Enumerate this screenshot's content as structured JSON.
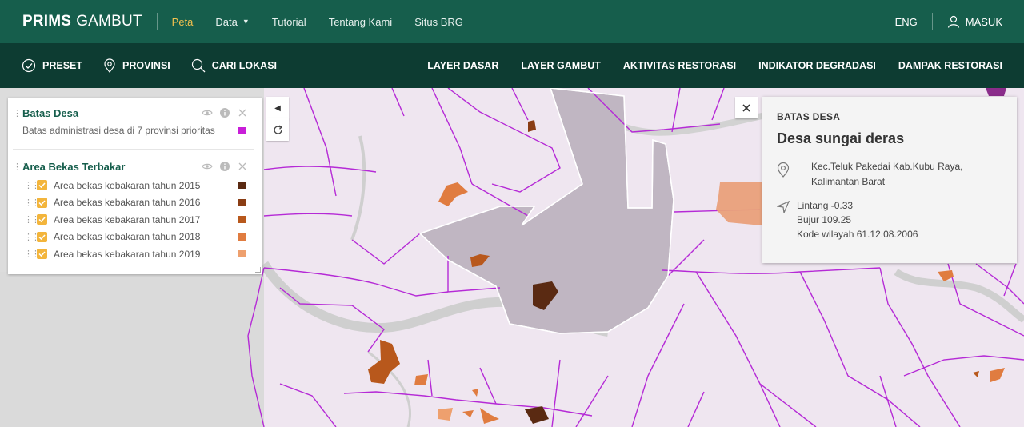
{
  "header": {
    "brand_bold": "PRIMS",
    "brand_light": "GAMBUT",
    "nav": [
      {
        "label": "Peta",
        "active": true
      },
      {
        "label": "Data",
        "has_caret": true
      },
      {
        "label": "Tutorial"
      },
      {
        "label": "Tentang Kami"
      },
      {
        "label": "Situs BRG"
      }
    ],
    "lang": "ENG",
    "login": "MASUK"
  },
  "subnav": {
    "left": [
      {
        "label": "PRESET",
        "icon": "check-circle-icon"
      },
      {
        "label": "PROVINSI",
        "icon": "map-pin-icon"
      },
      {
        "label": "CARI LOKASI",
        "icon": "search-icon"
      }
    ],
    "right": [
      "LAYER DASAR",
      "LAYER GAMBUT",
      "AKTIVITAS RESTORASI",
      "INDIKATOR DEGRADASI",
      "DAMPAK RESTORASI"
    ]
  },
  "legend": {
    "group1": {
      "title": "Batas Desa",
      "desc": "Batas administrasi desa di 7 provinsi prioritas",
      "color": "#c81ed8"
    },
    "group2": {
      "title": "Area Bekas Terbakar",
      "items": [
        {
          "label": "Area bekas kebakaran tahun 2015",
          "color": "#5a2a12"
        },
        {
          "label": "Area bekas kebakaran tahun 2016",
          "color": "#8a3d14"
        },
        {
          "label": "Area bekas kebakaran tahun 2017",
          "color": "#b8581c"
        },
        {
          "label": "Area bekas kebakaran tahun 2018",
          "color": "#e07c40"
        },
        {
          "label": "Area bekas kebakaran tahun 2019",
          "color": "#eea06e"
        }
      ]
    }
  },
  "info": {
    "category": "BATAS DESA",
    "name": "Desa sungai deras",
    "address_line1": "Kec.Teluk Pakedai Kab.Kubu Raya,",
    "address_line2": "Kalimantan Barat",
    "lat": "Lintang -0.33",
    "lon": "Bujur 109.25",
    "code": "Kode wilayah 61.12.08.2006"
  },
  "colors": {
    "topbar": "#165e4c",
    "subbar": "#0d3c32",
    "active": "#f2c14e",
    "boundary": "#b52ad6",
    "selected": "#c1b7c3"
  }
}
